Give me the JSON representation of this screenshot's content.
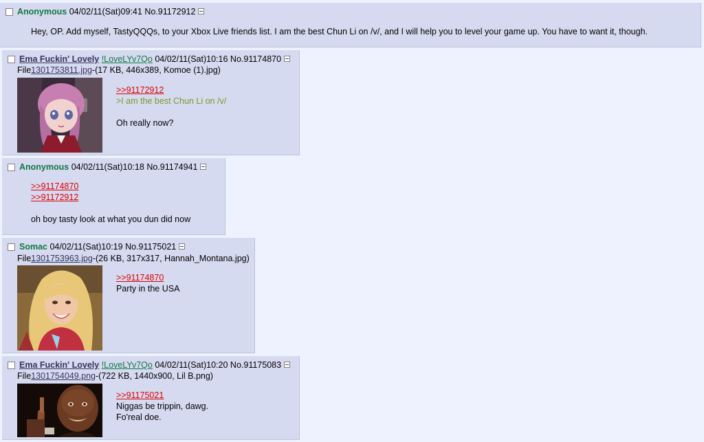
{
  "posts": [
    {
      "name": "Anonymous",
      "datetime": "04/02/11(Sat)09:41",
      "number": "No.91172912",
      "body": "Hey, OP. Add myself, TastyQQQs, to your Xbox Live friends list. I am the best Chun Li on /v/, and I will help you to level your game up. You have to want it, though."
    },
    {
      "name": "Ema Fuckin' Lovely",
      "tripcode": "!LoveLYv7Qo",
      "datetime": "04/02/11(Sat)10:16",
      "number": "No.91174870",
      "file_prefix": "File",
      "file_link": "1301753811.jpg",
      "file_info": "-(17 KB, 446x389, Komoe (1).jpg)",
      "thumb_icon": "anime-girl-thumbnail",
      "quote": ">>91172912",
      "greentext": ">I am the best Chun Li on /v/",
      "text": "Oh really now?"
    },
    {
      "name": "Anonymous",
      "datetime": "04/02/11(Sat)10:18",
      "number": "No.91174941",
      "quote1": ">>91174870",
      "quote2": ">>91172912",
      "text": "oh boy tasty look at what you dun did now"
    },
    {
      "name": "Somac",
      "datetime": "04/02/11(Sat)10:19",
      "number": "No.91175021",
      "file_prefix": "File",
      "file_link": "1301753963.jpg",
      "file_info": "-(26 KB, 317x317, Hannah_Montana.jpg)",
      "thumb_icon": "blonde-girl-photo-thumbnail",
      "quote": ">>91174870",
      "text": "Party in the USA"
    },
    {
      "name": "Ema Fuckin' Lovely",
      "tripcode": "!LoveLYv7Qo",
      "datetime": "04/02/11(Sat)10:20",
      "number": "No.91175083",
      "file_prefix": "File",
      "file_link": "1301754049.png",
      "file_info": "-(722 KB, 1440x900, Lil B.png)",
      "thumb_icon": "rapper-photo-thumbnail",
      "quote": ">>91175021",
      "text1": "Niggas be trippin, dawg.",
      "text2": "Fo'real doe."
    }
  ],
  "colors": {
    "page_bg": "#eef2ff",
    "post_bg": "#d6daf0",
    "anon_name": "#117743",
    "link_name": "#34345c",
    "quote_link": "#dd0000",
    "greentext": "#789922"
  }
}
